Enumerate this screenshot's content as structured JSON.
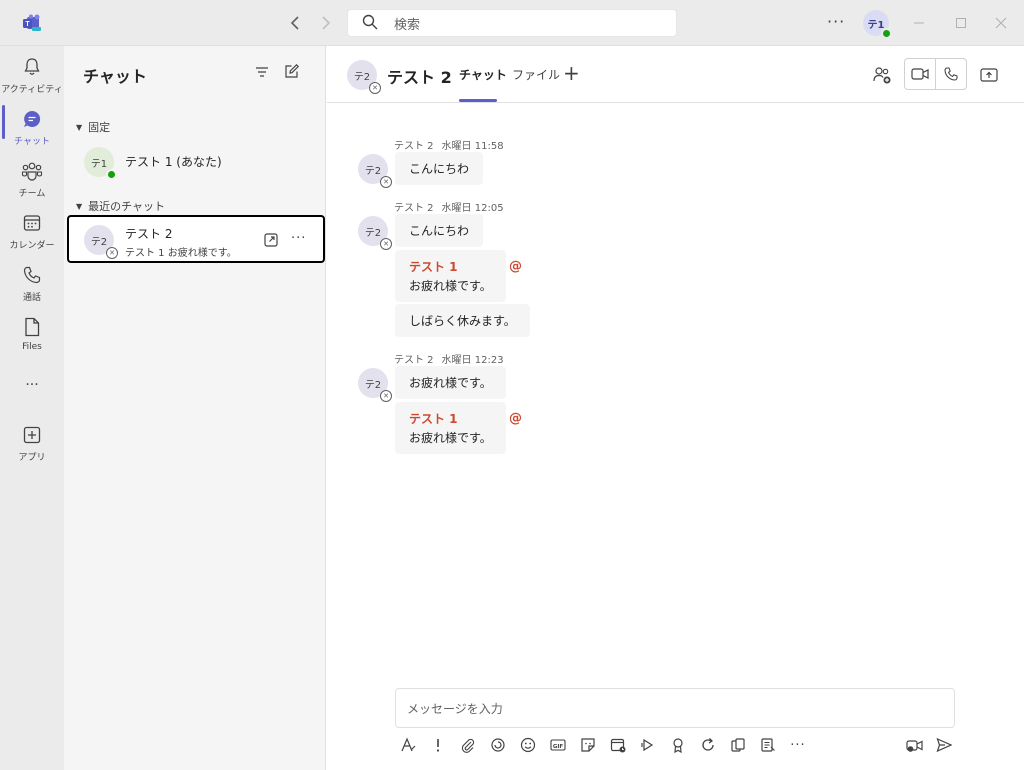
{
  "search": {
    "placeholder": "検索"
  },
  "titlebar": {
    "more": "···",
    "avatar_initials": "テ1"
  },
  "rail": {
    "items": [
      {
        "label": "アクティビティ",
        "icon": "bell-icon"
      },
      {
        "label": "チャット",
        "icon": "chat-icon",
        "active": true
      },
      {
        "label": "チーム",
        "icon": "teams-icon"
      },
      {
        "label": "カレンダー",
        "icon": "calendar-icon"
      },
      {
        "label": "通話",
        "icon": "phone-icon"
      },
      {
        "label": "Files",
        "icon": "file-icon"
      },
      {
        "label": "···",
        "icon": "more-icon"
      },
      {
        "label": "アプリ",
        "icon": "add-app-icon"
      }
    ]
  },
  "chatlist": {
    "title": "チャット",
    "pinned_header": "固定",
    "recent_header": "最近のチャット",
    "pinned": [
      {
        "initials": "テ1",
        "name": "テスト 1 (あなた)"
      }
    ],
    "recent": [
      {
        "initials": "テ2",
        "name": "テスト 2",
        "preview": "テスト 1 お疲れ様です。",
        "more": "···"
      }
    ]
  },
  "header": {
    "initials": "テ2",
    "title": "テスト 2",
    "tabs": [
      "チャット",
      "ファイル"
    ],
    "add_tab": "+"
  },
  "messages": {
    "groups": [
      {
        "avatar": "テ2",
        "sender": "テスト 2",
        "day": "水曜日",
        "time": "11:58",
        "items": [
          {
            "text": "こんにちわ"
          }
        ]
      },
      {
        "avatar": "テ2",
        "sender": "テスト 2",
        "day": "水曜日",
        "time": "12:05",
        "items": [
          {
            "text": "こんにちわ"
          },
          {
            "mention": "テスト 1",
            "text": "お疲れ様です。",
            "at": "@"
          },
          {
            "text": "しばらく休みます。"
          }
        ]
      },
      {
        "avatar": "テ2",
        "sender": "テスト 2",
        "day": "水曜日",
        "time": "12:23",
        "items": [
          {
            "text": "お疲れ様です。"
          },
          {
            "mention": "テスト 1",
            "text": "お疲れ様です。",
            "at": "@"
          }
        ]
      }
    ]
  },
  "compose": {
    "placeholder": "メッセージを入力",
    "gif_label": "GIF",
    "more": "···"
  },
  "colors": {
    "accent": "#5b5fc7",
    "mention": "#cc4a31",
    "available": "#13a10e"
  }
}
